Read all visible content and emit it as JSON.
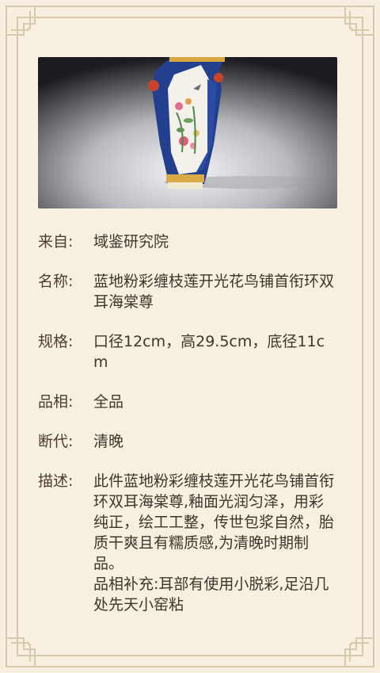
{
  "colors": {
    "background": "#f7efe0",
    "frame": "#d9c9ac",
    "text": "#4a3e33"
  },
  "image": {
    "icon": "vase-photo"
  },
  "details": {
    "source_label": "来自:",
    "source_value": "域鉴研究院",
    "name_label": "名称:",
    "name_value": "蓝地粉彩缠枝莲开光花鸟铺首衔环双耳海棠尊",
    "spec_label": "规格:",
    "spec_value": "口径12cm，高29.5cm，底径11cm",
    "condition_label": "品相:",
    "condition_value": "全品",
    "period_label": "断代:",
    "period_value": "清晚",
    "desc_label": "描述:",
    "desc_value": "此件蓝地粉彩缠枝莲开光花鸟铺首衔环双耳海棠尊,釉面光润匀泽，用彩纯正，绘工工整，传世包浆自然，胎质干爽且有糯质感,为清晚时期制品。",
    "desc_supplement": "品相补充:耳部有使用小脱彩,足沿几处先天小窑粘"
  }
}
